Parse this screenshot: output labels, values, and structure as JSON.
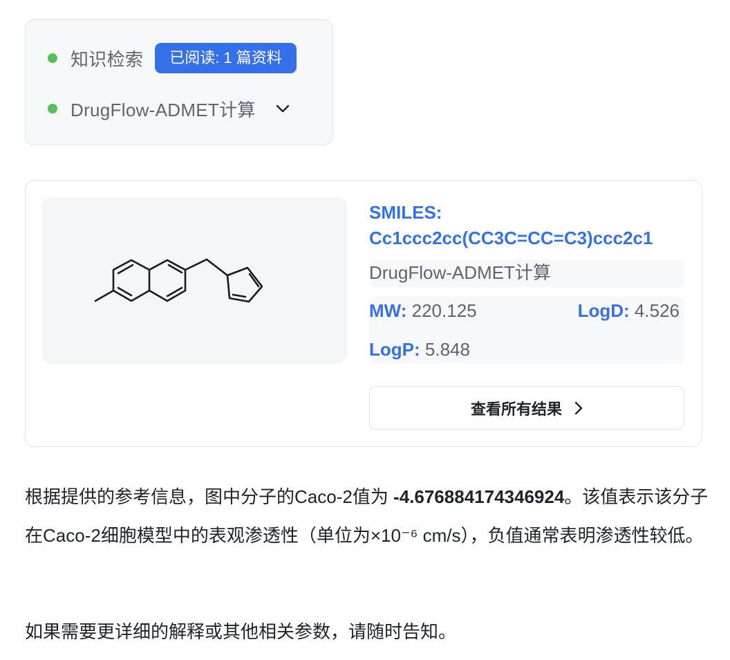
{
  "steps": {
    "knowledge": {
      "label": "知识检索",
      "badge": "已阅读: 1 篇资料",
      "status_color": "#54c25c"
    },
    "admet": {
      "label": "DrugFlow-ADMET计算",
      "status_color": "#54c25c",
      "chevron": "chevron-down-icon"
    }
  },
  "result": {
    "smiles_label": "SMILES:",
    "smiles_value": "Cc1ccc2cc(CC3C=CC=C3)ccc2c1",
    "tool": "DrugFlow-ADMET计算",
    "props": {
      "mw_label": "MW:",
      "mw_value": "220.125",
      "logd_label": "LogD:",
      "logd_value": "4.526",
      "logp_label": "LogP:",
      "logp_value": "5.848"
    },
    "view_all_label": "查看所有结果",
    "view_all_icon": "chevron-right-icon"
  },
  "answer": {
    "p1_before": "根据提供的参考信息，图中分子的Caco-2值为 ",
    "p1_value": "-4.676884174346924",
    "p1_after": "。该值表示该分子在Caco-2细胞模型中的表观渗透性（单位为×10⁻⁶ cm/s），负值通常表明渗透性较低。",
    "p2": "如果需要更详细的解释或其他相关参数，请随时告知。"
  },
  "colors": {
    "accent": "#3670e8",
    "success": "#54c25c",
    "muted_text": "#5e6470",
    "card_border": "#dfe3ea"
  }
}
